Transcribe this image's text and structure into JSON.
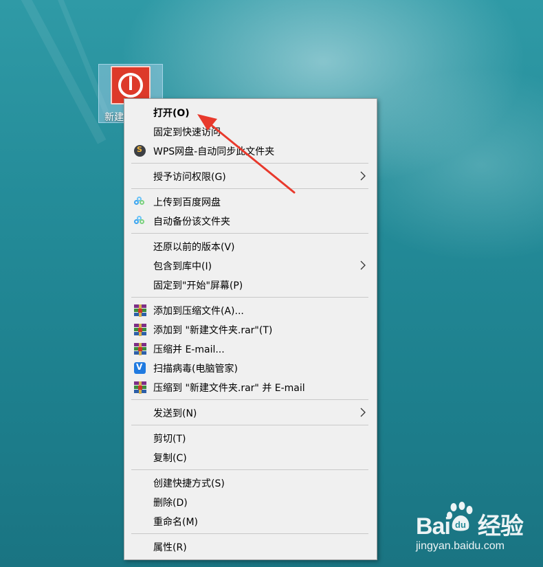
{
  "desktop": {
    "icon_label": "新建"
  },
  "menu": {
    "items": [
      {
        "label": "打开(O)"
      },
      {
        "label": "固定到快速访问"
      },
      {
        "label": "WPS网盘-自动同步此文件夹",
        "icon": "wps-cloud-icon"
      },
      {
        "label": "授予访问权限(G)"
      },
      {
        "label": "上传到百度网盘",
        "icon": "baidu-netdisk-icon"
      },
      {
        "label": "自动备份该文件夹",
        "icon": "baidu-netdisk-icon"
      },
      {
        "label": "还原以前的版本(V)"
      },
      {
        "label": "包含到库中(I)"
      },
      {
        "label": "固定到\"开始\"屏幕(P)"
      },
      {
        "label": "添加到压缩文件(A)...",
        "icon": "winrar-icon"
      },
      {
        "label": "添加到 \"新建文件夹.rar\"(T)",
        "icon": "winrar-icon"
      },
      {
        "label": "压缩并 E-mail...",
        "icon": "winrar-icon"
      },
      {
        "label": "扫描病毒(电脑管家)",
        "icon": "tencent-pc-manager-icon"
      },
      {
        "label": "压缩到 \"新建文件夹.rar\" 并 E-mail",
        "icon": "winrar-icon"
      },
      {
        "label": "发送到(N)"
      },
      {
        "label": "剪切(T)"
      },
      {
        "label": "复制(C)"
      },
      {
        "label": "创建快捷方式(S)"
      },
      {
        "label": "删除(D)"
      },
      {
        "label": "重命名(M)"
      },
      {
        "label": "属性(R)"
      }
    ]
  },
  "annotation": {
    "color": "#e8392c"
  },
  "watermark": {
    "logo": "Bai du 经验",
    "url": "jingyan.baidu.com"
  }
}
